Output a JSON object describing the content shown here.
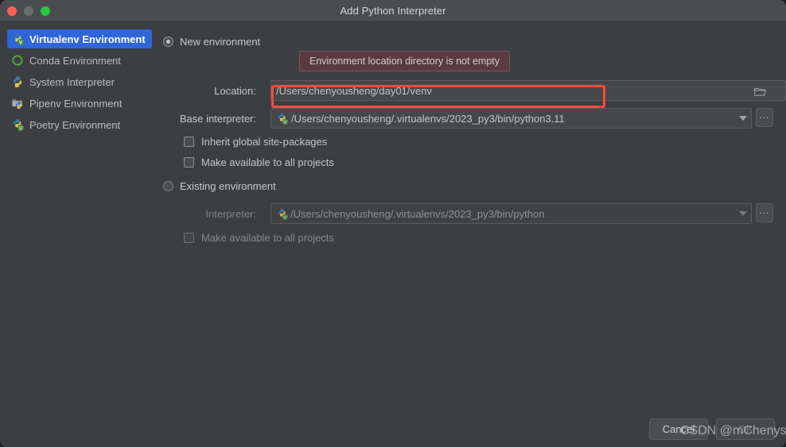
{
  "window": {
    "title": "Add Python Interpreter",
    "traffic_lights": [
      {
        "name": "close",
        "color": "#ff5f57"
      },
      {
        "name": "minimize",
        "color": "#6c6f70"
      },
      {
        "name": "zoom",
        "color": "#28c840"
      }
    ],
    "background": "#3c3f41"
  },
  "sidebar": {
    "items": [
      {
        "label": "Virtualenv Environment",
        "icon": "python-venv-icon",
        "selected": true
      },
      {
        "label": "Conda Environment",
        "icon": "conda-circle-icon",
        "selected": false
      },
      {
        "label": "System Interpreter",
        "icon": "python-icon",
        "selected": false
      },
      {
        "label": "Pipenv Environment",
        "icon": "pipenv-folder-icon",
        "selected": false
      },
      {
        "label": "Poetry Environment",
        "icon": "python-venv-icon",
        "selected": false
      }
    ],
    "selected_color": "#2f65d8"
  },
  "main": {
    "new_environment": {
      "radio_label": "New environment",
      "selected": true,
      "warning": "Environment location directory is not empty",
      "warning_bg": "#5b3b41",
      "location_label": "Location:",
      "location_value": "/Users/chenyousheng/day01/venv",
      "location_browse_icon": "folder-icon",
      "base_interpreter_label": "Base interpreter:",
      "base_interpreter_value": "/Users/chenyousheng/.virtualenvs/2023_py3/bin/python3.11",
      "base_interpreter_icon": "python-venv-icon",
      "base_interpreter_dots": "...",
      "checkboxes": [
        {
          "label": "Inherit global site-packages",
          "checked": false,
          "enabled": true
        },
        {
          "label": "Make available to all projects",
          "checked": false,
          "enabled": true
        }
      ]
    },
    "existing_environment": {
      "radio_label": "Existing environment",
      "selected": false,
      "interpreter_label": "Interpreter:",
      "interpreter_value": "/Users/chenyousheng/.virtualenvs/2023_py3/bin/python",
      "interpreter_icon": "python-venv-icon",
      "interpreter_dots": "...",
      "checkboxes": [
        {
          "label": "Make available to all projects",
          "checked": false,
          "enabled": false
        }
      ]
    }
  },
  "footer": {
    "cancel_label": "Cancel",
    "ok_label": "OK",
    "ok_enabled": false
  },
  "annotation": {
    "highlight_color": "#fa4b42",
    "watermark": "CSDN @mChenys"
  }
}
